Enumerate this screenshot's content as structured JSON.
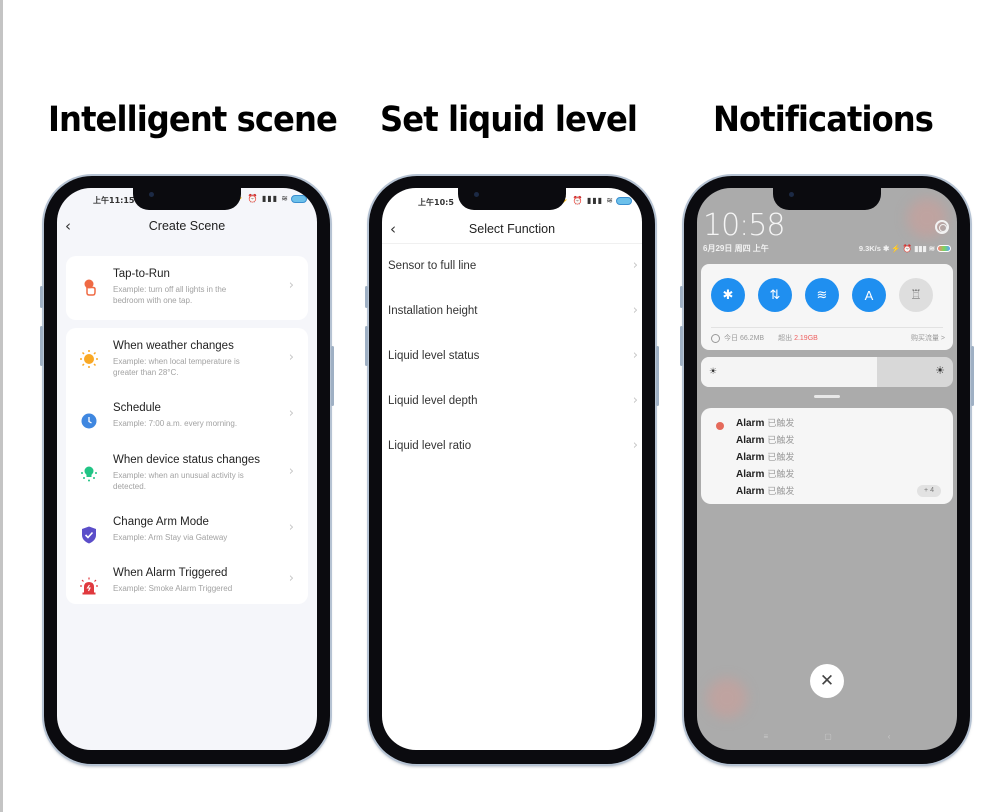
{
  "headings": [
    "Intelligent scene",
    "Set liquid level",
    "Notifications"
  ],
  "phone1": {
    "status_time": "上午11:15",
    "status_icons": "⚡ ⏰ ▮▮▮ ≋",
    "title": "Create Scene",
    "back_icon": "‹",
    "items": [
      {
        "icon": "tap-icon",
        "title": "Tap-to-Run",
        "desc": "Example: turn off all lights in the bedroom with one tap.",
        "color": "#ef6a44"
      },
      {
        "icon": "weather-sun-icon",
        "title": "When weather changes",
        "desc": "Example: when local temperature is greater than 28°C.",
        "color": "#f9a825"
      },
      {
        "icon": "clock-icon",
        "title": "Schedule",
        "desc": "Example: 7:00 a.m. every morning.",
        "color": "#3f87e0"
      },
      {
        "icon": "device-bulb-icon",
        "title": "When device status changes",
        "desc": "Example: when an unusual activity is detected.",
        "color": "#21c485"
      },
      {
        "icon": "shield-check-icon",
        "title": "Change Arm Mode",
        "desc": "Example: Arm Stay via Gateway",
        "color": "#5b4ec9"
      },
      {
        "icon": "alarm-siren-icon",
        "title": "When Alarm Triggered",
        "desc": "Example: Smoke Alarm Triggered",
        "color": "#e0393e"
      }
    ],
    "chevron": "›"
  },
  "phone2": {
    "status_time": "上午10:5",
    "status_icons": "⚡ ⏰ ▮▮▮ ≋",
    "title": "Select Function",
    "back_icon": "‹",
    "items": [
      "Sensor to full line",
      "Installation height",
      "Liquid level status",
      "Liquid level depth",
      "Liquid level ratio"
    ],
    "chevron": "›"
  },
  "phone3": {
    "time": "10:58",
    "date": "6月29日 周四 上午",
    "net_speed": "9.3K/s ✱ ⚡ ⏰ ▮▮▮ ≋",
    "quick_settings": [
      {
        "name": "bluetooth",
        "glyph": "✱",
        "on": true
      },
      {
        "name": "mobile-data",
        "glyph": "⇅",
        "on": true
      },
      {
        "name": "wifi",
        "glyph": "≋",
        "on": true
      },
      {
        "name": "auto-brightness",
        "glyph": "A",
        "on": true
      },
      {
        "name": "flashlight",
        "glyph": "♖",
        "on": false
      }
    ],
    "data_usage": {
      "today": "今日 66.2MB",
      "exceeded_label": "超出",
      "exceeded_value": "2.19GB",
      "buy": "购买流量 >"
    },
    "brightness_level": 0.7,
    "sun_small": "☀",
    "sun_large": "☀",
    "notification": {
      "rows": [
        {
          "title": "Alarm",
          "sub": "已触发"
        },
        {
          "title": "Alarm",
          "sub": "已触发"
        },
        {
          "title": "Alarm",
          "sub": "已触发"
        },
        {
          "title": "Alarm",
          "sub": "已触发"
        },
        {
          "title": "Alarm",
          "sub": "已触发"
        }
      ],
      "more_count": "+ 4"
    },
    "close_icon": "✕",
    "nav_buttons": [
      "≡",
      "▢",
      "‹"
    ]
  }
}
